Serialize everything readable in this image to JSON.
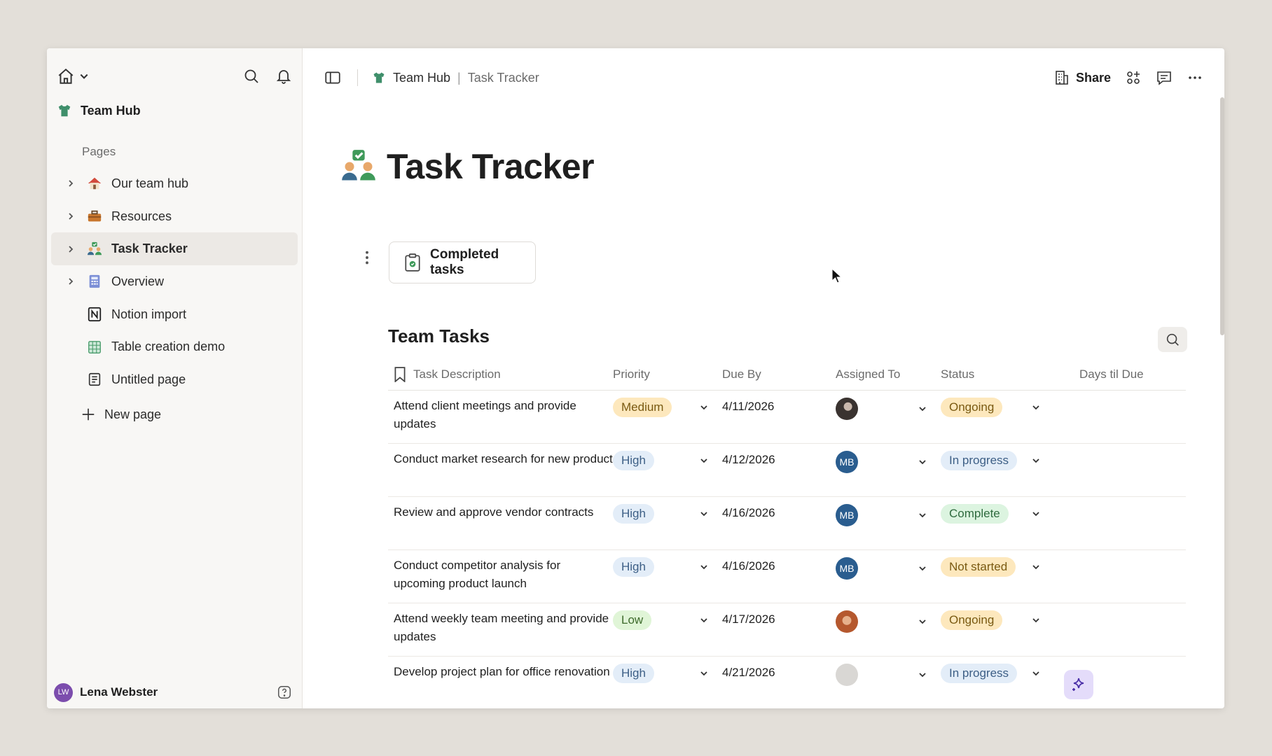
{
  "sidebar": {
    "workspace": "Team Hub",
    "pages_label": "Pages",
    "items": [
      {
        "label": "Our team hub"
      },
      {
        "label": "Resources"
      },
      {
        "label": "Task Tracker"
      },
      {
        "label": "Overview"
      },
      {
        "label": "Notion import"
      },
      {
        "label": "Table creation demo"
      },
      {
        "label": "Untitled page"
      }
    ],
    "new_page": "New page",
    "user": {
      "name": "Lena Webster",
      "initials": "LW"
    }
  },
  "topbar": {
    "breadcrumb_1": "Team Hub",
    "breadcrumb_sep": "|",
    "breadcrumb_2": "Task Tracker",
    "share_label": "Share"
  },
  "page": {
    "title": "Task Tracker",
    "linked_card": "Completed tasks"
  },
  "table": {
    "title": "Team Tasks",
    "columns": [
      "Task Description",
      "Priority",
      "Due By",
      "Assigned To",
      "Status",
      "Days til Due"
    ],
    "rows": [
      {
        "desc": "Attend client meetings and provide updates",
        "priority": "Medium",
        "due": "4/11/2026",
        "assignee": "",
        "status": "Ongoing"
      },
      {
        "desc": "Conduct market research for new product",
        "priority": "High",
        "due": "4/12/2026",
        "assignee": "MB",
        "status": "In progress"
      },
      {
        "desc": "Review and approve vendor contracts",
        "priority": "High",
        "due": "4/16/2026",
        "assignee": "MB",
        "status": "Complete"
      },
      {
        "desc": "Conduct competitor analysis for upcoming product launch",
        "priority": "High",
        "due": "4/16/2026",
        "assignee": "MB",
        "status": "Not started"
      },
      {
        "desc": "Attend weekly team meeting and provide updates",
        "priority": "Low",
        "due": "4/17/2026",
        "assignee": "",
        "status": "Ongoing"
      },
      {
        "desc": "Develop project plan for office renovation",
        "priority": "High",
        "due": "4/21/2026",
        "assignee": "",
        "status": "In progress"
      }
    ]
  },
  "colors": {
    "medium": "#fde8bd",
    "high": "#e3edf8",
    "low": "#e0f5d7",
    "in_progress": "#e3edf8",
    "complete": "#dcf4e0",
    "ongoing": "#fde8bd",
    "avatar_mb": "#2a5d8f",
    "user_avatar": "#7c4dad"
  }
}
